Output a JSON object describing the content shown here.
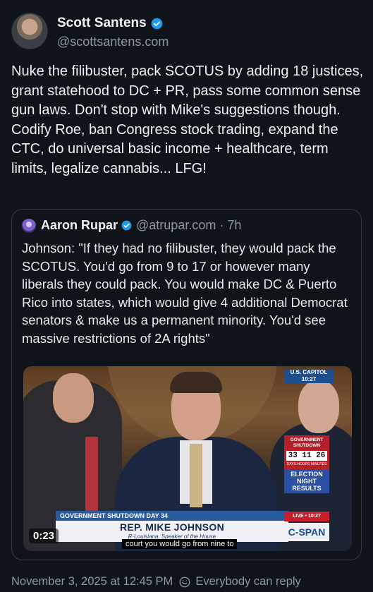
{
  "author": {
    "display_name": "Scott Santens",
    "handle": "@scottsantens.com",
    "verified": true
  },
  "post": {
    "text": "Nuke the filibuster, pack SCOTUS by adding 18 justices, grant statehood to DC + PR, pass some common sense gun laws. Don't stop with Mike's suggestions though. Codify Roe, ban Congress stock trading, expand the CTC, do universal basic income + healthcare, term limits, legalize cannabis... LFG!"
  },
  "quote": {
    "display_name": "Aaron Rupar",
    "handle_time": "@atrupar.com · 7h",
    "verified": true,
    "text": "Johnson: \"If they had no filibuster, they would pack the SCOTUS. You'd go from 9 to 17 or however many liberals they could pack. You would make DC & Puerto Rico into states, which would give 4 additional Democrat senators & make us a permanent minority. You'd see massive restrictions of 2A rights\""
  },
  "video": {
    "duration": "0:23",
    "caption": "court you would go from nine to",
    "lower_third_top": "GOVERNMENT SHUTDOWN DAY 34",
    "lower_third_name": "REP. MIKE JOHNSON",
    "lower_third_sub": "R-Louisiana, Speaker of the House",
    "capitol_tag": "U.S. CAPITOL",
    "capitol_time": "10:27",
    "shutdown_label": "GOVERNMENT SHUTDOWN",
    "shutdown_counter": "33 11 26",
    "shutdown_sub": "DAYS HOURS MINUTES",
    "election_label": "ELECTION NIGHT RESULTS",
    "live_label": "LIVE • 10:27",
    "network": "C-SPAN"
  },
  "footer": {
    "timestamp": "November 3, 2025 at 12:45 PM",
    "reply_setting": "Everybody can reply"
  },
  "colors": {
    "background": "#0f141b",
    "verified": "#1d9bf0",
    "muted": "#8b98a5"
  }
}
